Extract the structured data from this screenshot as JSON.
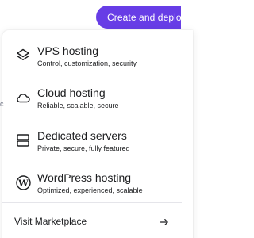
{
  "header": {
    "deploy_button_label": "Create and deploy",
    "deploy_button_icon": "chevron-up-icon",
    "accent_color": "#673de6"
  },
  "menu": {
    "edge_mark": "c",
    "items": [
      {
        "icon": "layers-icon",
        "title": "VPS hosting",
        "description": "Control, customization, security"
      },
      {
        "icon": "cloud-icon",
        "title": "Cloud hosting",
        "description": "Reliable, scalable, secure"
      },
      {
        "icon": "server-icon",
        "title": "Dedicated servers",
        "description": "Private, secure, fully featured"
      },
      {
        "icon": "wordpress-icon",
        "title": "WordPress hosting",
        "description": "Optimized, experienced, scalable"
      }
    ],
    "footer": {
      "label": "Visit Marketplace",
      "icon": "arrow-right-icon"
    }
  }
}
